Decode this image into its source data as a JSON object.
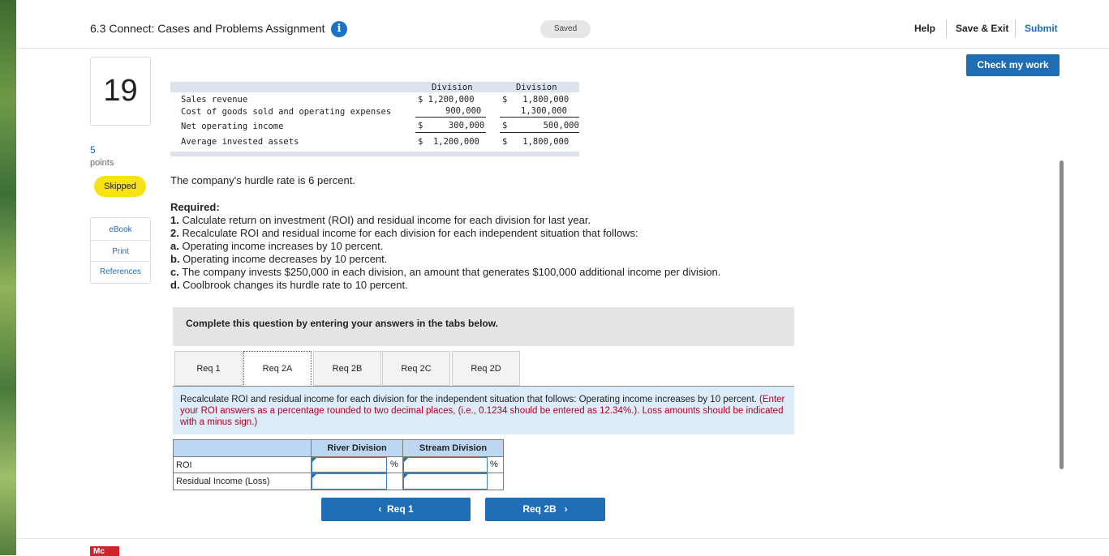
{
  "header": {
    "assignment_title": "6.3 Connect: Cases and Problems Assignment",
    "info_icon": "info-icon",
    "saved_status": "Saved",
    "help_label": "Help",
    "save_exit_label": "Save & Exit",
    "submit_label": "Submit",
    "check_work_label": "Check my work"
  },
  "question": {
    "number": "19",
    "points_value": "5",
    "points_label": "points",
    "status": "Skipped",
    "resources": [
      "eBook",
      "Print",
      "References"
    ]
  },
  "financials": {
    "col_headers": [
      "Division",
      "Division"
    ],
    "rows": [
      {
        "label": "Sales revenue",
        "col1": "$ 1,200,000",
        "col2": "$   1,800,000"
      },
      {
        "label": "Cost of goods sold and operating expenses",
        "col1": "900,000",
        "col2": "1,300,000"
      },
      {
        "label": "Net operating income",
        "col1": "$     300,000",
        "col2": "$       500,000"
      },
      {
        "label": "Average invested assets",
        "col1": "$  1,200,000",
        "col2": "$   1,800,000"
      }
    ]
  },
  "problem": {
    "hurdle_text": "The company's hurdle rate is 6 percent.",
    "required_label": "Required:",
    "items": [
      {
        "num": "1.",
        "text": " Calculate return on investment (ROI) and residual income for each division for last year."
      },
      {
        "num": "2.",
        "text": " Recalculate ROI and residual income for each division for each independent situation that follows:"
      },
      {
        "num": "a.",
        "text": " Operating income increases by 10 percent."
      },
      {
        "num": "b.",
        "text": " Operating income decreases by 10 percent."
      },
      {
        "num": "c.",
        "text": " The company invests $250,000 in each division, an amount that generates $100,000 additional income per division."
      },
      {
        "num": "d.",
        "text": " Coolbrook changes its hurdle rate to 10 percent."
      }
    ]
  },
  "answer_panel": {
    "complete_instruction": "Complete this question by entering your answers in the tabs below.",
    "tabs": [
      "Req 1",
      "Req 2A",
      "Req 2B",
      "Req 2C",
      "Req 2D"
    ],
    "active_tab": "Req 2A",
    "instruction_main": "Recalculate ROI and residual income for each division for the independent situation that follows: Operating income increases by 10 percent.",
    "instruction_note": "(Enter your ROI answers as a percentage rounded to two decimal places, (i.e., 0.1234 should be entered as 12.34%.). Loss amounts should be indicated with a minus sign.)",
    "table": {
      "col_headers": [
        "River Division",
        "Stream Division"
      ],
      "rows": [
        {
          "label": "ROI",
          "unit": "%"
        },
        {
          "label": "Residual Income (Loss)",
          "unit": ""
        }
      ]
    },
    "prev_button": "Req 1",
    "next_button": "Req 2B"
  },
  "footer": {
    "logo_text": "Mc"
  },
  "colors": {
    "accent": "#1f6db5",
    "skipped_badge": "#f7e214",
    "table_header": "#bcd7f1",
    "instruction_bg": "#dcebf8",
    "note_red": "#b00020"
  }
}
